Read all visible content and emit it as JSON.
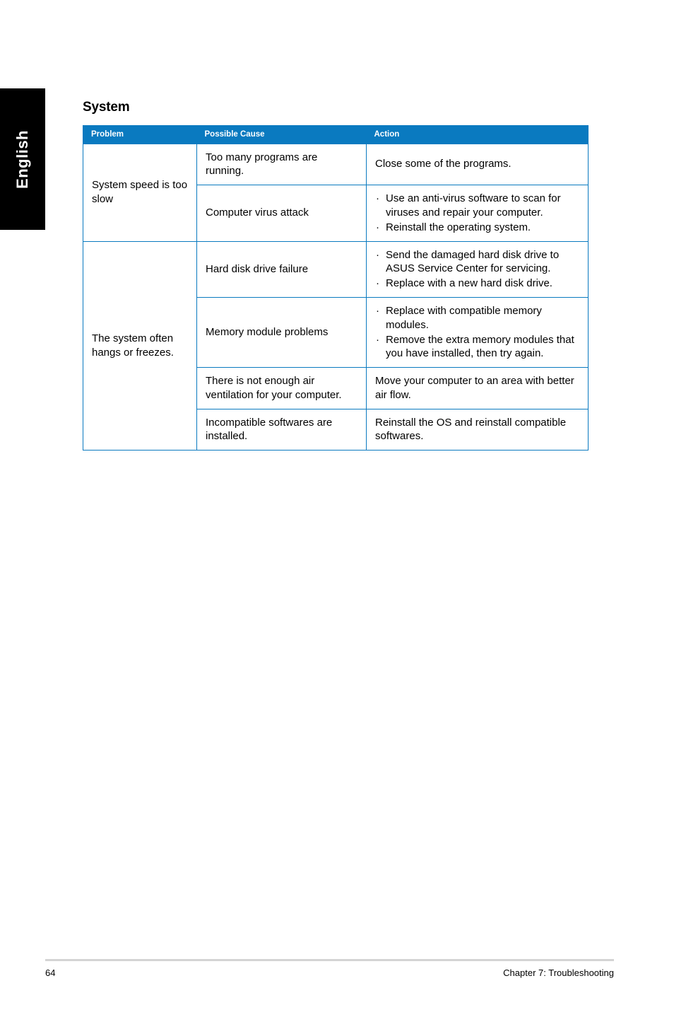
{
  "language_tab": {
    "label": "English"
  },
  "section": {
    "title": "System"
  },
  "colors": {
    "table_accent": "#0a7ac0",
    "header_text": "#ffffff",
    "tab_background": "#000000",
    "footer_rule": "#d4d4d4"
  },
  "table": {
    "headers": {
      "problem": "Problem",
      "cause": "Possible Cause",
      "action": "Action"
    },
    "groups": [
      {
        "problem": "System speed is too slow",
        "rows": [
          {
            "cause": "Too many programs are running.",
            "action_text": "Close some of the programs.",
            "action_bullets": []
          },
          {
            "cause": "Computer virus attack",
            "action_text": "",
            "action_bullets": [
              "Use an anti-virus software to scan for viruses and repair your computer.",
              "Reinstall the operating system."
            ]
          }
        ]
      },
      {
        "problem": "The system often hangs or freezes.",
        "rows": [
          {
            "cause": "Hard disk drive failure",
            "action_text": "",
            "action_bullets": [
              "Send the damaged hard disk drive to ASUS Service Center for servicing.",
              "Replace with a new hard disk drive."
            ]
          },
          {
            "cause": "Memory module problems",
            "action_text": "",
            "action_bullets": [
              "Replace with compatible memory modules.",
              "Remove the extra memory modules that you have installed, then try again."
            ]
          },
          {
            "cause": "There is not enough air ventilation for your computer.",
            "action_text": "Move your computer to an area with better air flow.",
            "action_bullets": []
          },
          {
            "cause": "Incompatible softwares are installed.",
            "action_text": "Reinstall the OS and reinstall compatible softwares.",
            "action_bullets": []
          }
        ]
      }
    ]
  },
  "footer": {
    "page_number": "64",
    "chapter": "Chapter 7: Troubleshooting"
  },
  "bullet_glyph": "·"
}
